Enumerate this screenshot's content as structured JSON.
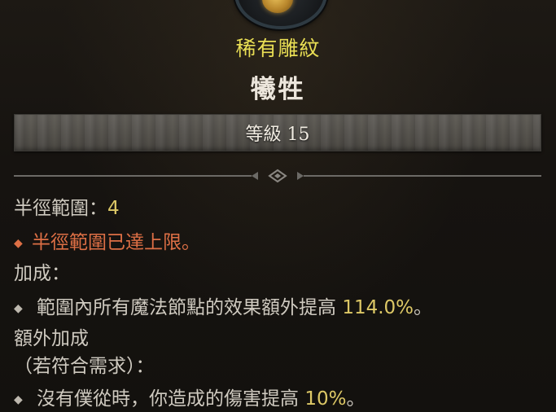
{
  "tooltip": {
    "rarity": "稀有雕紋",
    "name": "犧牲",
    "level_label": "等級 15",
    "stats": {
      "radius_label": "半徑範圍：",
      "radius_value": "4",
      "radius_max_note": "半徑範圍已達上限。",
      "bonus_heading": "加成：",
      "bonus_text": "範圍內所有魔法節點的效果額外提高 ",
      "bonus_value": "114.0%",
      "bonus_end": "。",
      "extra_heading": "額外加成",
      "extra_requirement": "（若符合需求）：",
      "extra_text": "沒有僕從時，你造成的傷害提高 ",
      "extra_value": "10%",
      "extra_end": "。"
    },
    "bullet_glyph": "◆",
    "icons": {
      "emblem": "glyph-emblem-icon",
      "divider": "ornament-divider-icon"
    },
    "colors": {
      "rarity": "#e9de54",
      "value": "#ddc866",
      "warning": "#dd6f45",
      "text": "#cfcac0"
    }
  }
}
